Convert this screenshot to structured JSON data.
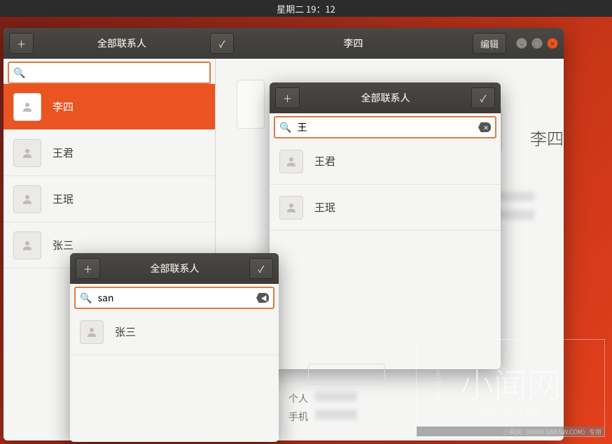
{
  "topbar": {
    "clock": "星期二 19：12"
  },
  "main_window": {
    "left_header_title": "全部联系人",
    "right_header_title": "李四",
    "edit_label": "编辑",
    "search_value": "",
    "contacts": [
      {
        "name": "李四",
        "selected": true
      },
      {
        "name": "王君",
        "selected": false
      },
      {
        "name": "王珉",
        "selected": false
      },
      {
        "name": "张三",
        "selected": false
      }
    ],
    "detail": {
      "name": "李四",
      "rows": [
        {
          "label": "个人"
        },
        {
          "label": "手机"
        }
      ]
    }
  },
  "window2": {
    "header_title": "全部联系人",
    "search_value": "王",
    "contacts": [
      {
        "name": "王君"
      },
      {
        "name": "王珉"
      }
    ]
  },
  "window3": {
    "header_title": "全部联系人",
    "search_value": "san",
    "contacts": [
      {
        "name": "张三"
      }
    ]
  },
  "lower_detail": {
    "rows": [
      {
        "label": "个人"
      },
      {
        "label": "手机"
      }
    ]
  },
  "watermark": {
    "text": "小闻网",
    "sub": "XWENW.COM",
    "bar": "小闻网（WWW.XWENW.COM）专用"
  }
}
